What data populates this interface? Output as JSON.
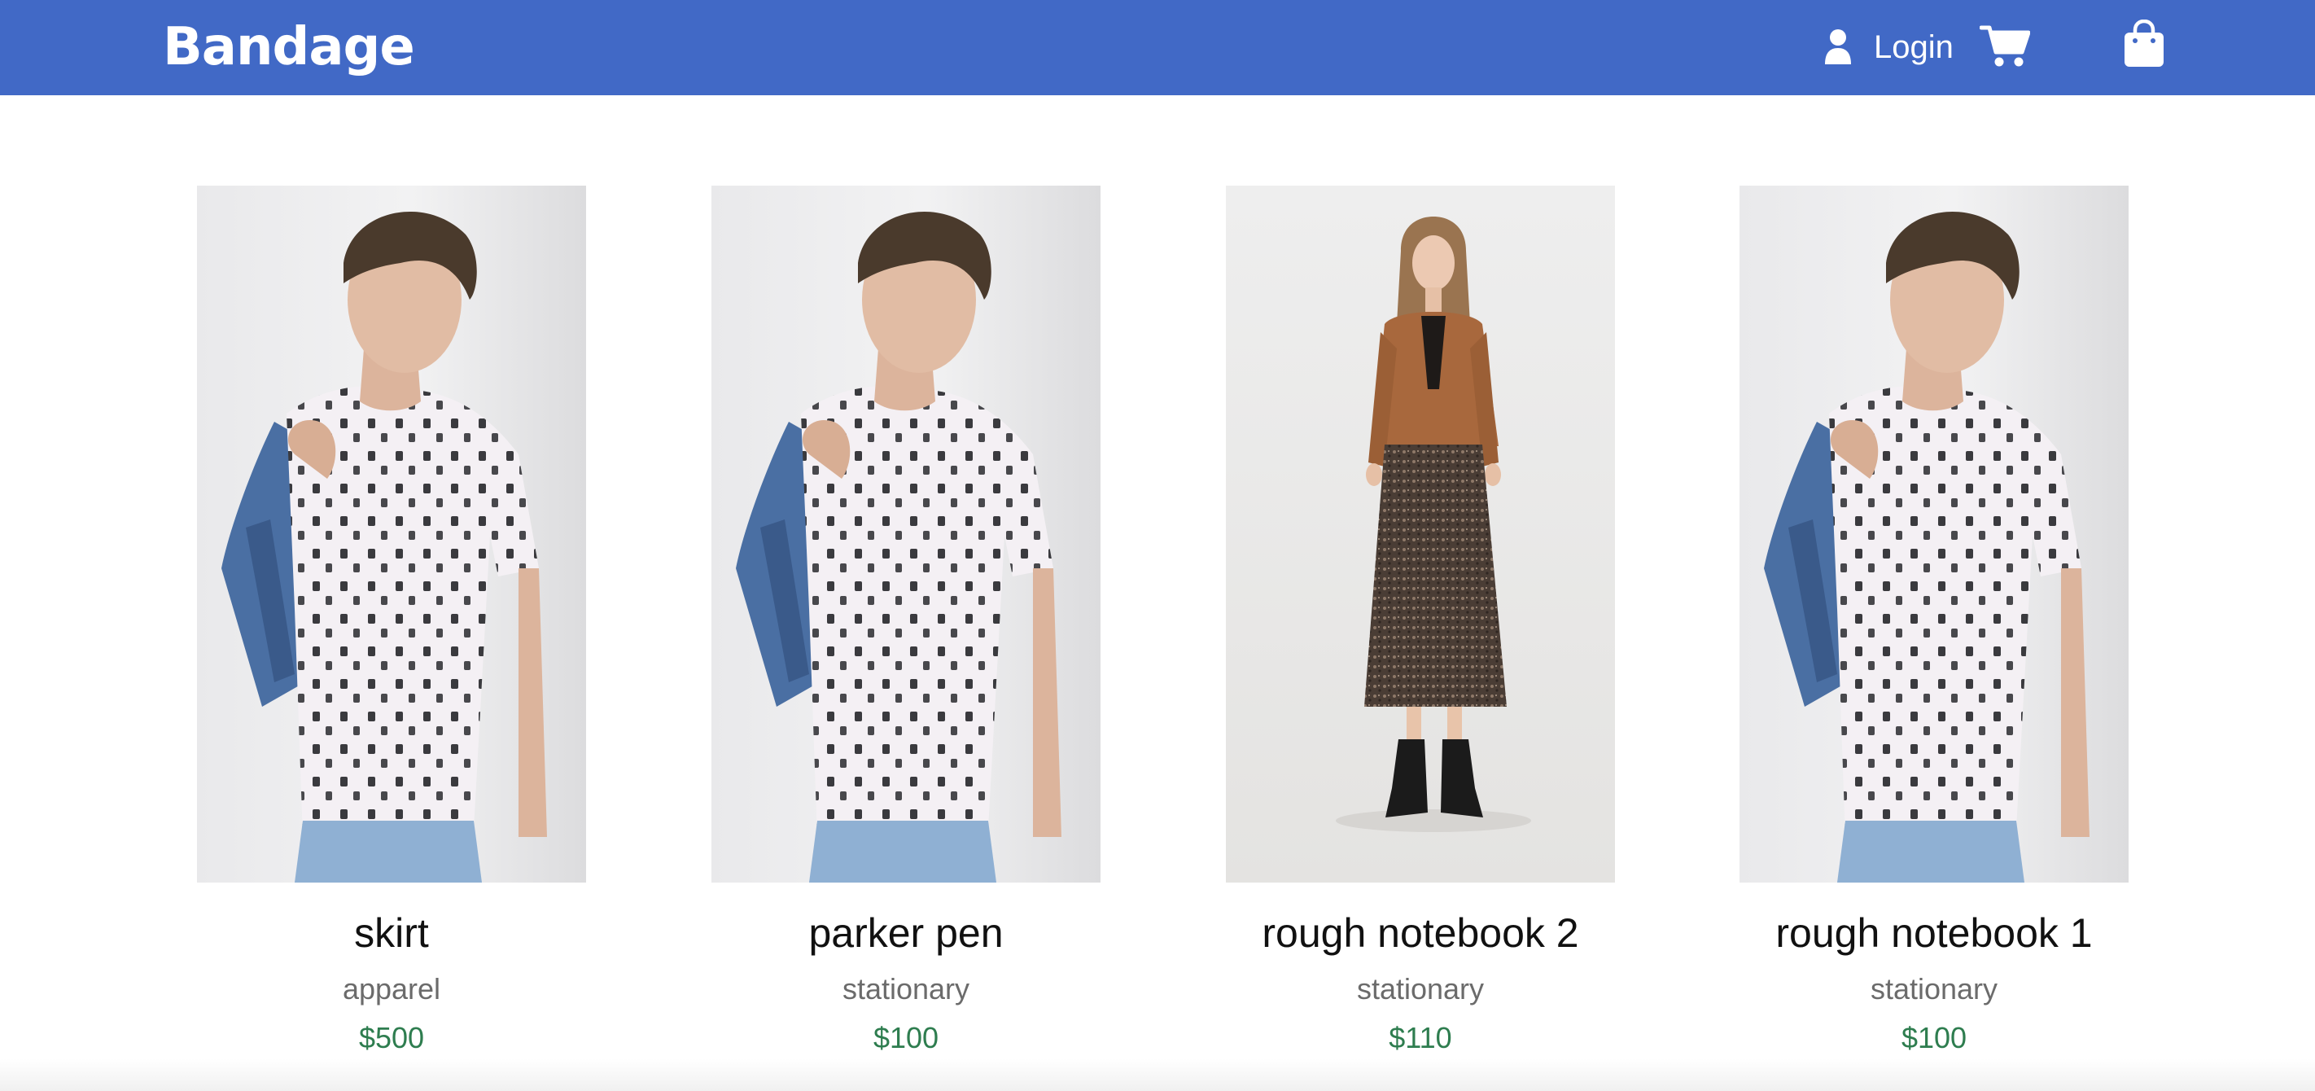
{
  "header": {
    "brand": "Bandage",
    "login_label": "Login",
    "user_icon": "user-icon",
    "cart_icon": "shopping-cart-icon",
    "bag_icon": "shopping-bag-icon",
    "background_color": "#4169c6"
  },
  "products": [
    {
      "name": "skirt",
      "category": "apparel",
      "price": "$500",
      "image": "man-printed-tshirt-denim-jacket"
    },
    {
      "name": "parker pen",
      "category": "stationary",
      "price": "$100",
      "image": "man-printed-tshirt-denim-jacket"
    },
    {
      "name": "rough notebook 2",
      "category": "stationary",
      "price": "$110",
      "image": "woman-brown-jacket-patterned-skirt"
    },
    {
      "name": "rough notebook 1",
      "category": "stationary",
      "price": "$100",
      "image": "man-printed-tshirt-denim-jacket"
    }
  ],
  "colors": {
    "price": "#2e7d4f",
    "category": "#6b6b6b"
  }
}
